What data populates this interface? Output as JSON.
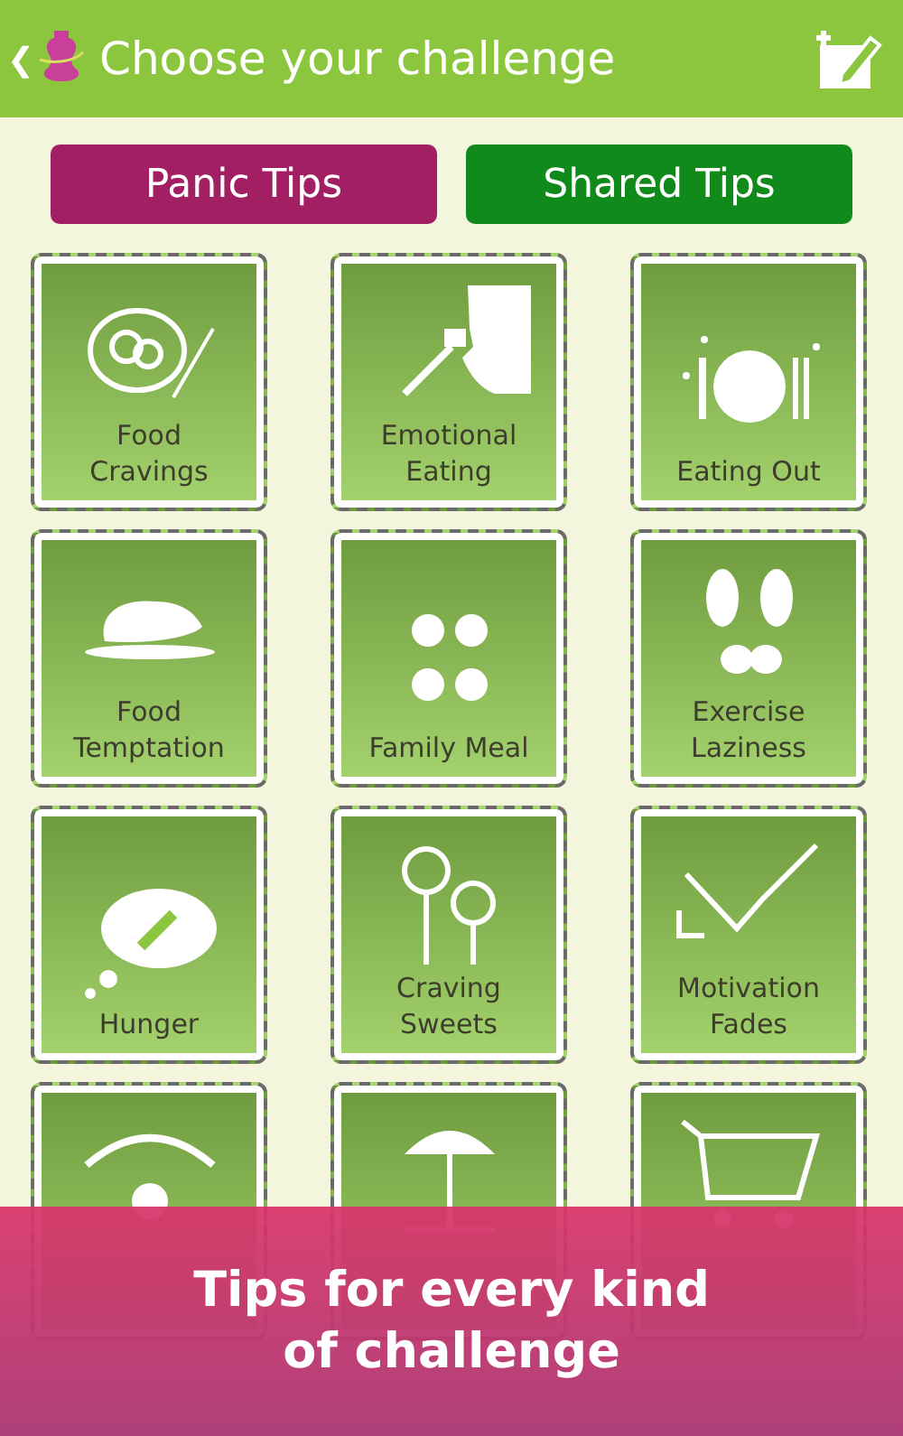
{
  "header": {
    "back": "❮",
    "title": "Choose your challenge"
  },
  "buttons": [
    {
      "label": "Panic Tips",
      "color": "#a21f63"
    },
    {
      "label": "Shared Tips",
      "color": "#108a1b"
    }
  ],
  "tiles": [
    {
      "kind": "labeled",
      "label": "Food\nCravings"
    },
    {
      "kind": "labeled",
      "label": "Emotional\nEating"
    },
    {
      "kind": "labeled",
      "label": "Eating Out"
    },
    {
      "kind": "labeled",
      "label": "Food\nTemptation"
    },
    {
      "kind": "labeled",
      "label": "Family Meal"
    },
    {
      "kind": "labeled",
      "label": "Exercise\nLaziness"
    },
    {
      "kind": "labeled",
      "label": "Hunger"
    },
    {
      "kind": "labeled",
      "label": "Craving\nSweets"
    },
    {
      "kind": "labeled",
      "label": "Motivation\nFades"
    },
    {
      "kind": "covered"
    },
    {
      "kind": "covered"
    },
    {
      "kind": "covered"
    }
  ],
  "banner": {
    "text": "Tips for every kind\nof challenge"
  }
}
